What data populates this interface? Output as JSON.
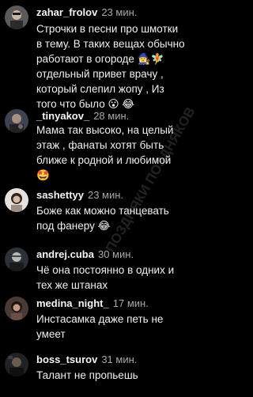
{
  "comments": [
    {
      "username": "zahar_frolov",
      "time": "23 мин.",
      "lines": [
        "Строчки в песни про шмотки",
        "в тему. В таких вещах обычно",
        "работают в огороде 🧙‍♀️🧚",
        "отдельный привет врачу ,",
        "который слепил жопу , Из",
        "того что было 😮 😂"
      ]
    },
    {
      "username": "_tinyakov_",
      "time": "28 мин.",
      "lines": [
        "Мама так высоко, на целый",
        "этаж , фанаты хотят быть",
        "ближе к родной и любимой",
        "🤩"
      ]
    },
    {
      "username": "sashettyy",
      "time": "23 мин.",
      "lines": [
        "Боже как можно танцевать",
        "под фанеру 😂"
      ]
    },
    {
      "username": "andrej.cuba",
      "time": "30 мин.",
      "lines": [
        "Чё она постоянно в одних и",
        "тех же штанах"
      ]
    },
    {
      "username": "medina_night_",
      "time": "17 мин.",
      "lines": [
        "Инстасамка даже петь не",
        "умеет"
      ]
    },
    {
      "username": "boss_tsurov",
      "time": "31 мин.",
      "lines": [
        "Талант не пропьешь"
      ]
    }
  ],
  "watermark": {
    "text": "ПОЗДНЯКИ ПОЗДНЯКОВ"
  }
}
